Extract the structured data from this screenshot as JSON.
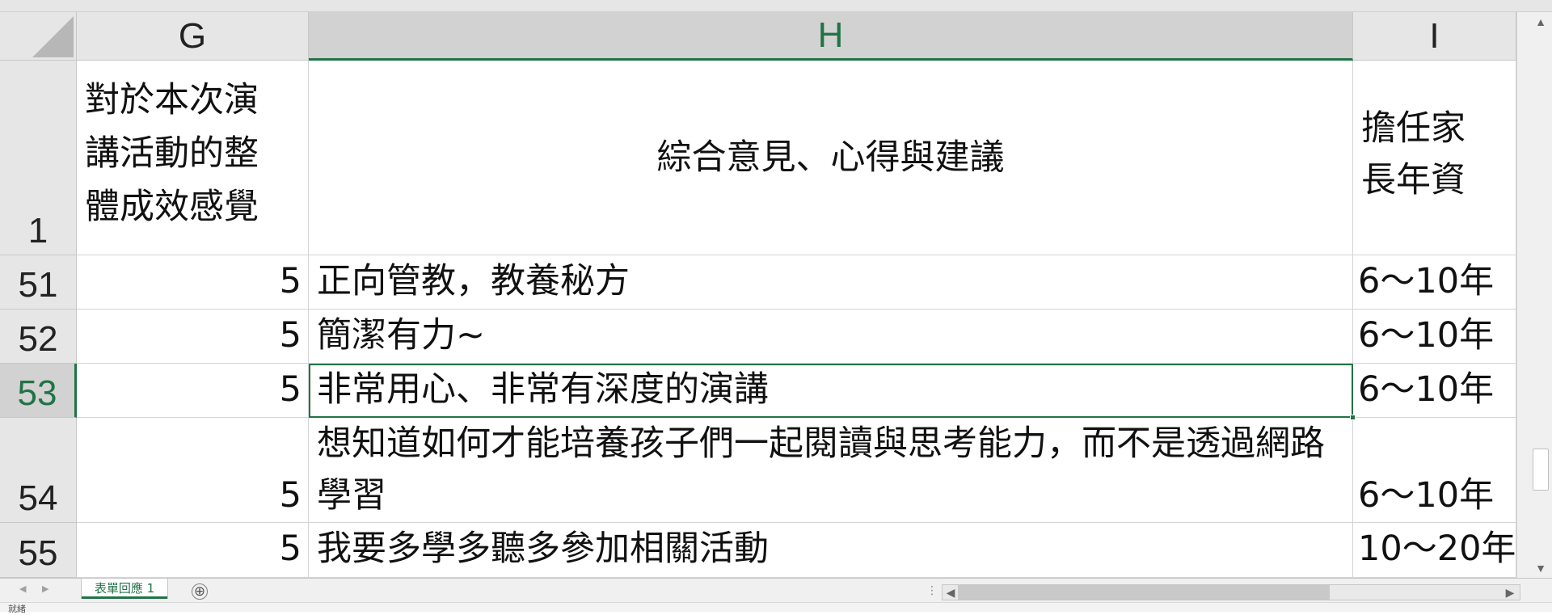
{
  "columns": [
    "G",
    "H",
    "I"
  ],
  "selected_column": "H",
  "header_row": {
    "row_number": "1",
    "g": "對於本次演講活動的整體成效感覺",
    "h": "綜合意見、心得與建議",
    "i": "擔任家長年資"
  },
  "rows": [
    {
      "row": "51",
      "g": "5",
      "h": "正向管教，教養秘方",
      "i": "6～10年"
    },
    {
      "row": "52",
      "g": "5",
      "h": "簡潔有力~",
      "i": "6～10年"
    },
    {
      "row": "53",
      "g": "5",
      "h": "非常用心、非常有深度的演講",
      "i": "6～10年"
    },
    {
      "row": "54",
      "g": "5",
      "h": "想知道如何才能培養孩子們一起閱讀與思考能力，而不是透過網路學習",
      "i": "6～10年"
    },
    {
      "row": "55",
      "g": "5",
      "h": "我要多學多聽多參加相關活動",
      "i": "10～20年"
    }
  ],
  "active_cell": "H53",
  "sheet_tabs": [
    "表單回應 1"
  ],
  "add_sheet_symbol": "⊕",
  "status_text": "就緒",
  "colors": {
    "accent": "#217346",
    "header_bg": "#e6e6e6",
    "selected_header_bg": "#d2d2d2"
  }
}
